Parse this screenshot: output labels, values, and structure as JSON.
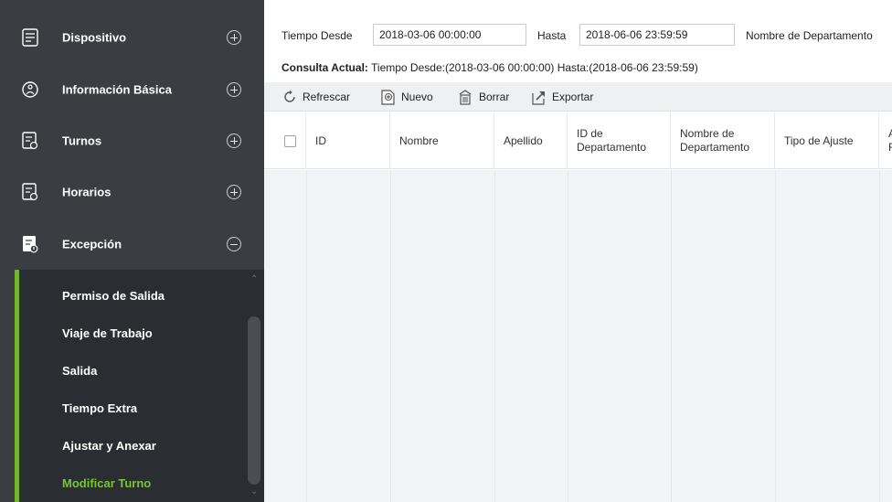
{
  "sidebar": {
    "menu": [
      {
        "label": "Dispositivo",
        "icon": "device-icon",
        "toggle": "expand"
      },
      {
        "label": "Información Básica",
        "icon": "info-icon",
        "toggle": "expand"
      },
      {
        "label": "Turnos",
        "icon": "shift-icon",
        "toggle": "expand"
      },
      {
        "label": "Horarios",
        "icon": "schedule-icon",
        "toggle": "expand"
      },
      {
        "label": "Excepción",
        "icon": "exception-icon",
        "toggle": "collapse"
      }
    ],
    "submenu": [
      {
        "label": "Permiso de Salida"
      },
      {
        "label": "Viaje de Trabajo"
      },
      {
        "label": "Salida"
      },
      {
        "label": "Tiempo Extra"
      },
      {
        "label": "Ajustar y Anexar"
      },
      {
        "label": "Modificar Turno",
        "active": true
      }
    ],
    "colors": {
      "bg": "#3a3d42",
      "submenu_bg": "#2a2d31",
      "accent": "#72b52a",
      "active_text": "#7cc23b"
    }
  },
  "filter": {
    "time_from_label": "Tiempo Desde",
    "time_from_value": "2018-03-06 00:00:00",
    "until_label": "Hasta",
    "until_value": "2018-06-06 23:59:59",
    "dept_label": "Nombre de Departamento"
  },
  "query": {
    "label": "Consulta Actual:",
    "text": "Tiempo Desde:(2018-03-06 00:00:00)  Hasta:(2018-06-06 23:59:59)"
  },
  "toolbar": {
    "refresh": "Refrescar",
    "new": "Nuevo",
    "delete": "Borrar",
    "export": "Exportar"
  },
  "table": {
    "columns": [
      {
        "line1": "ID",
        "line2": ""
      },
      {
        "line1": "Nombre",
        "line2": ""
      },
      {
        "line1": "Apellido",
        "line2": ""
      },
      {
        "line1": "ID de",
        "line2": "Departamento"
      },
      {
        "line1": "Nombre de",
        "line2": "Departamento"
      },
      {
        "line1": "Tipo de Ajuste",
        "line2": ""
      },
      {
        "line1": "A",
        "line2": "F"
      }
    ],
    "rows": []
  }
}
